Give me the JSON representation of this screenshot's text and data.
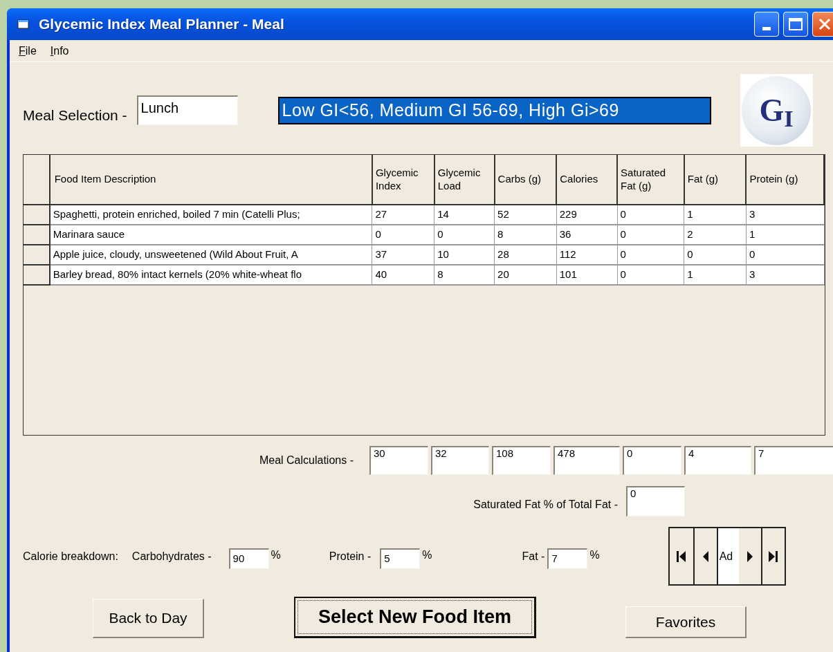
{
  "window": {
    "title": "Glycemic Index Meal Planner - Meal"
  },
  "menu": [
    {
      "label": "File"
    },
    {
      "label": "Info"
    }
  ],
  "meal_selection": {
    "label": "Meal Selection -",
    "value": "Lunch"
  },
  "gi_legend": "Low GI<56, Medium GI 56-69, High Gi>69",
  "logo": {
    "text": "G$_{I}$"
  },
  "table": {
    "columns": [
      "Food Item Description",
      "Glycemic Index",
      "Glycemic Load",
      "Carbs (g)",
      "Calories",
      "Saturated Fat (g)",
      "Fat (g)",
      "Protein (g)"
    ],
    "rows": [
      [
        "Spaghetti, protein enriched, boiled 7 min (Catelli Plus;",
        "27",
        "14",
        "52",
        "229",
        "0",
        "1",
        "3"
      ],
      [
        "Marinara sauce",
        "0",
        "0",
        "8",
        "36",
        "0",
        "2",
        "1"
      ],
      [
        "Apple juice, cloudy, unsweetened (Wild About Fruit, A",
        "37",
        "10",
        "28",
        "112",
        "0",
        "0",
        "0"
      ],
      [
        "Barley bread, 80% intact kernels (20% white-wheat flo",
        "40",
        "8",
        "20",
        "101",
        "0",
        "1",
        "3"
      ]
    ]
  },
  "meal_calculations": {
    "label": "Meal Calculations -",
    "values": [
      "30",
      "32",
      "108",
      "478",
      "0",
      "4",
      "7"
    ]
  },
  "saturated_fat": {
    "label": "Saturated Fat % of Total Fat -",
    "value": "0"
  },
  "calorie_breakdown": {
    "label": "Calorie breakdown:",
    "items": [
      {
        "label": "Carbohydrates -",
        "value": "90",
        "unit": "%"
      },
      {
        "label": "Protein -",
        "value": "5",
        "unit": "%"
      },
      {
        "label": "Fat -",
        "value": "7",
        "unit": "%"
      }
    ]
  },
  "navigator": {
    "caption": "Ad"
  },
  "buttons": [
    {
      "label": "Back to Day",
      "kind": "normal",
      "focused": false
    },
    {
      "label": "Select New Food Item",
      "kind": "large",
      "focused": true
    },
    {
      "label": "Favorites",
      "kind": "normal",
      "focused": false
    }
  ]
}
